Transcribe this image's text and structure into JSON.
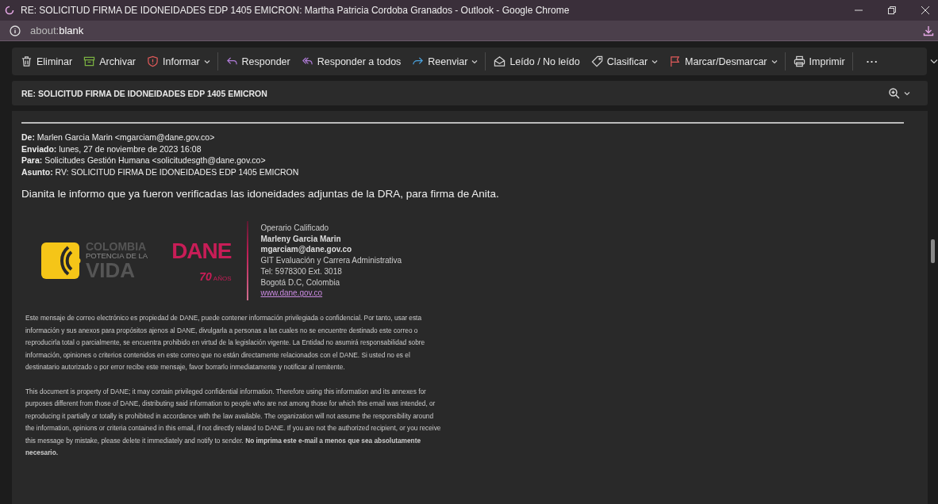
{
  "window": {
    "title": "RE: SOLICITUD FIRMA DE IDONEIDADES EDP 1405 EMICRON: Martha Patricia Cordoba Granados - Outlook - Google Chrome"
  },
  "address_bar": {
    "prefix": "about:",
    "host": "blank"
  },
  "toolbar": [
    {
      "label": "Eliminar",
      "dropdown": false,
      "separator_after": false
    },
    {
      "label": "Archivar",
      "dropdown": false,
      "separator_after": false
    },
    {
      "label": "Informar",
      "dropdown": true,
      "separator_after": true
    },
    {
      "label": "Responder",
      "dropdown": false,
      "separator_after": false
    },
    {
      "label": "Responder a todos",
      "dropdown": false,
      "separator_after": false
    },
    {
      "label": "Reenviar",
      "dropdown": true,
      "separator_after": true
    },
    {
      "label": "Leído / No leído",
      "dropdown": false,
      "separator_after": false
    },
    {
      "label": "Clasificar",
      "dropdown": true,
      "separator_after": false
    },
    {
      "label": "Marcar/Desmarcar",
      "dropdown": true,
      "separator_after": true
    },
    {
      "label": "Imprimir",
      "dropdown": false,
      "separator_after": true
    }
  ],
  "more_button": "···",
  "subject": "RE: SOLICITUD FIRMA DE IDONEIDADES EDP 1405 EMICRON",
  "headers": [
    {
      "label": "De:",
      "value": "Marlen Garcia Marin <mgarciam@dane.gov.co>"
    },
    {
      "label": "Enviado:",
      "value": "lunes, 27 de noviembre de 2023 16:08"
    },
    {
      "label": "Para:",
      "value": "Solicitudes Gestión Humana <solicitudesgth@dane.gov.co>"
    },
    {
      "label": "Asunto:",
      "value": "RV: SOLICITUD FIRMA DE IDONEIDADES EDP 1405 EMICRON"
    }
  ],
  "body": "Dianita le informo que ya fueron verificadas las idoneidades adjuntas de la DRA, para firma de Anita.",
  "logos": {
    "colombia": [
      "COLOMBIA",
      "POTENCIA DE LA",
      "VIDA"
    ],
    "dane": "DANE",
    "years": "70",
    "years_word": "AÑOS"
  },
  "signature": [
    {
      "kind": "plain",
      "text": "Operario Calificado"
    },
    {
      "kind": "bold",
      "text": "Marleny Garcia Marin"
    },
    {
      "kind": "bold",
      "text": "mgarciam@dane.gov.co"
    },
    {
      "kind": "plain",
      "text": "GIT Evaluación y Carrera Administrativa"
    },
    {
      "kind": "plain",
      "text": "Tel: 5978300 Ext. 3018"
    },
    {
      "kind": "plain",
      "text": "Bogotá D.C, Colombia"
    },
    {
      "kind": "link",
      "text": "www.dane.gov.co"
    }
  ],
  "disclaimer": [
    "Este mensaje de correo electrónico es propiedad de DANE, puede contener información privilegiada o confidencial. Por tanto, usar esta información y sus anexos para propósitos ajenos al DANE, divulgarla a personas a las cuales no se encuentre destinado este correo o reproducirla total o parcialmente, se encuentra prohibido en virtud de la legislación vigente. La Entidad no asumirá responsabilidad sobre información, opiniones o criterios contenidos en este correo que no están directamente relacionados con el DANE. Si usted no es el destinatario autorizado o por error recibe este mensaje, favor borrarlo inmediatamente y notificar al remitente.",
    "This document is property of DANE; it may contain privileged confidential information. Therefore using this information and its annexes for purposes different from those of DANE, distributing said information to people who are not among those for which this email was intended, or reproducing it partially or totally is prohibited in accordance with the law available. The organization will not assume the responsibility around the information, opinions or criteria contained in this email, if not directly related to DANE. If you are not the authorized recipient, or you receive this message by mistake, please delete it immediately and notify to sender. **No imprima este e-mail a menos que sea absolutamente necesario.**"
  ]
}
